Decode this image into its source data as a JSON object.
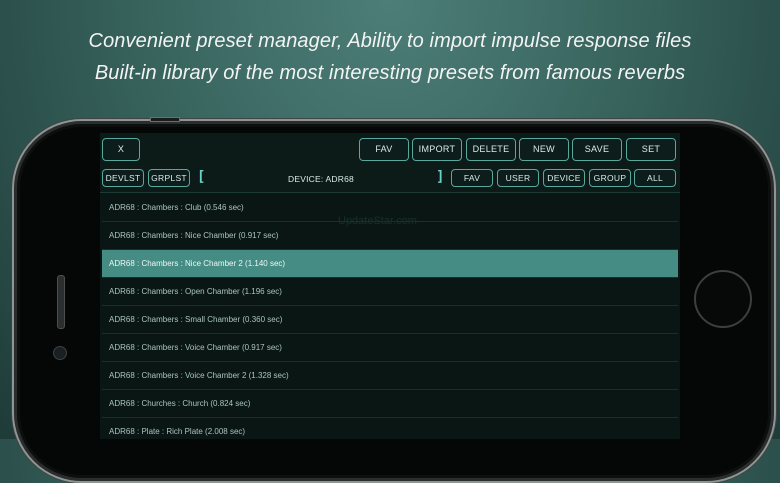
{
  "headline": {
    "line1": "Convenient preset manager, Ability to import impulse response files",
    "line2": "Built-in library of the most interesting presets from famous reverbs"
  },
  "watermark": "UpdateStar.com",
  "toolbar": {
    "close_label": "X",
    "fav_label": "FAV",
    "import_label": "IMPORT",
    "delete_label": "DELETE",
    "new_label": "NEW",
    "save_label": "SAVE",
    "set_label": "SET"
  },
  "filterbar": {
    "devlst_label": "DEVLST",
    "grplst_label": "GRPLST",
    "bracket_open": "[",
    "device_label": "DEVICE: ADR68",
    "bracket_close": "]",
    "fav_label": "FAV",
    "user_label": "USER",
    "device_btn_label": "DEVICE",
    "group_label": "GROUP",
    "all_label": "ALL"
  },
  "presets": [
    {
      "label": "ADR68 : Chambers : Club (0.546 sec)",
      "selected": false
    },
    {
      "label": "ADR68 : Chambers : Nice Chamber (0.917 sec)",
      "selected": false
    },
    {
      "label": "ADR68 : Chambers : Nice Chamber 2 (1.140 sec)",
      "selected": true
    },
    {
      "label": "ADR68 : Chambers : Open Chamber (1.196 sec)",
      "selected": false
    },
    {
      "label": "ADR68 : Chambers : Small Chamber (0.360 sec)",
      "selected": false
    },
    {
      "label": "ADR68 : Chambers : Voice Chamber (0.917 sec)",
      "selected": false
    },
    {
      "label": "ADR68 : Chambers : Voice Chamber 2 (1.328 sec)",
      "selected": false
    },
    {
      "label": "ADR68 : Churches : Church (0.824 sec)",
      "selected": false
    },
    {
      "label": "ADR68 : Plate : Rich Plate (2.008 sec)",
      "selected": false
    }
  ],
  "colors": {
    "accent": "#58a89d",
    "selected_row": "#458d84",
    "screen_bg": "#0a1614"
  }
}
